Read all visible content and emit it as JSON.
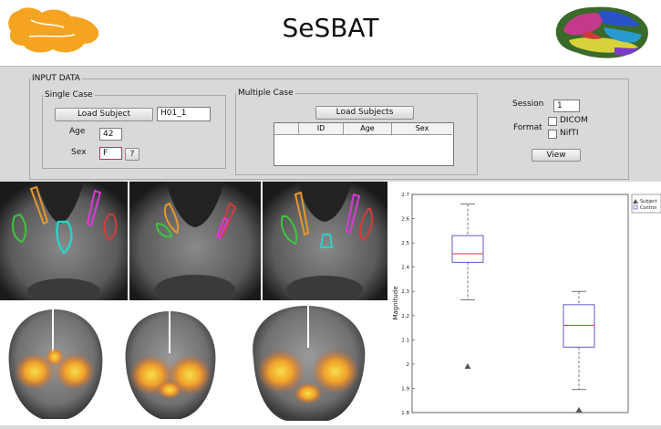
{
  "app": {
    "title": "SeSBAT"
  },
  "input": {
    "legend": "INPUT DATA",
    "single": {
      "legend": "Single Case",
      "load_label": "Load Subject",
      "subject_value": "H01_1",
      "age_label": "Age",
      "age_value": "42",
      "sex_label": "Sex",
      "sex_value": "F",
      "help_label": "?"
    },
    "multiple": {
      "legend": "Multiple Case",
      "load_label": "Load Subjects",
      "columns": [
        "ID",
        "Age",
        "Sex"
      ]
    },
    "session_label": "Session",
    "session_value": "1",
    "format_label": "Format",
    "formats": [
      "DICOM",
      "NifTI"
    ],
    "view_label": "View"
  },
  "plot": {
    "ylabel": "Magnitude",
    "legend": [
      "Subject",
      "Control"
    ],
    "colors": {
      "median": "#d83a3a",
      "box": "#4c4cc8",
      "whisker": "#555555",
      "marker": "#555555"
    }
  },
  "chart_data": {
    "type": "box",
    "ylabel": "Magnitude",
    "ylim": [
      1.8,
      2.7
    ],
    "yticks": [
      "1.8",
      "1.9",
      "2",
      "2.1",
      "2.2",
      "2.3",
      "2.4",
      "2.5",
      "2.6",
      "2.7"
    ],
    "series": [
      {
        "name": "Subject",
        "q1": 2.42,
        "median": 2.455,
        "q3": 2.53,
        "whisker_low": 2.265,
        "whisker_high": 2.66,
        "outliers": [
          1.99
        ]
      },
      {
        "name": "Control",
        "q1": 2.07,
        "median": 2.16,
        "q3": 2.245,
        "whisker_low": 1.895,
        "whisker_high": 2.3,
        "outliers": [
          1.81
        ]
      }
    ]
  }
}
